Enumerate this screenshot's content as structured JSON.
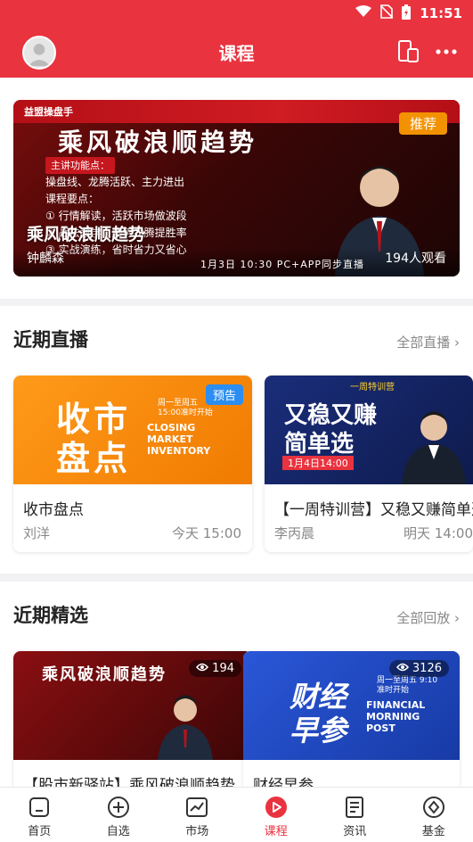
{
  "status_bar": {
    "time": "11:51"
  },
  "header": {
    "title": "课程"
  },
  "hero": {
    "badge": "推荐",
    "banner_title": "乘风破浪顺趋势",
    "brand": "益盟操盘手",
    "banner_points_head": "主讲功能点：",
    "banner_points": "操盘线、龙腾活跃、主力进出",
    "banner_course_head": "课程要点：",
    "banner_items": [
      "① 行情解读，活跃市场做波段",
      "② 战法教学，顺势龙腾提胜率",
      "③ 实战演练，省时省力又省心"
    ],
    "banner_date": "1月3日 10:30 PC+APP同步直播",
    "title": "乘风破浪顺趋势",
    "author": "钟麟森",
    "views": "194人观看"
  },
  "recent_live": {
    "heading": "近期直播",
    "more": "全部直播",
    "items": [
      {
        "badge": "预告",
        "thumb_big": "收市盘点",
        "thumb_line1": "收市",
        "thumb_line2": "盘点",
        "thumb_schedule": "周一至周五 15:00准时开始",
        "thumb_en": "CLOSING MARKET INVENTORY",
        "title": "收市盘点",
        "author": "刘洋",
        "time": "今天 15:00"
      },
      {
        "thumb_line1": "又稳又赚",
        "thumb_line2": "简单选",
        "thumb_tag": "一周特训营",
        "thumb_date": "1月4日14:00",
        "title": "【一周特训营】又稳又赚简单选",
        "author": "李丙晨",
        "time": "明天 14:00"
      }
    ]
  },
  "recent_pick": {
    "heading": "近期精选",
    "more": "全部回放",
    "items": [
      {
        "views": "194",
        "thumb_title": "乘风破浪顺趋势",
        "title": "【股市新驿站】乘风破浪顺趋势"
      },
      {
        "views": "3126",
        "thumb_line1": "财经",
        "thumb_line2": "早参",
        "thumb_schedule": "周一至周五 9:10准时开始",
        "thumb_en": "FINANCIAL MORNING POST",
        "title": "财经早参"
      }
    ]
  },
  "bottom_nav": {
    "items": [
      {
        "label": "首页",
        "icon": "home-icon"
      },
      {
        "label": "自选",
        "icon": "plus-circle-icon"
      },
      {
        "label": "市场",
        "icon": "chart-icon"
      },
      {
        "label": "课程",
        "icon": "play-icon"
      },
      {
        "label": "资讯",
        "icon": "news-icon"
      },
      {
        "label": "基金",
        "icon": "fund-icon"
      }
    ],
    "active_index": 3
  },
  "colors": {
    "brand_red": "#e9333f",
    "badge_orange": "#f39200",
    "badge_blue": "#2b8ef0"
  }
}
